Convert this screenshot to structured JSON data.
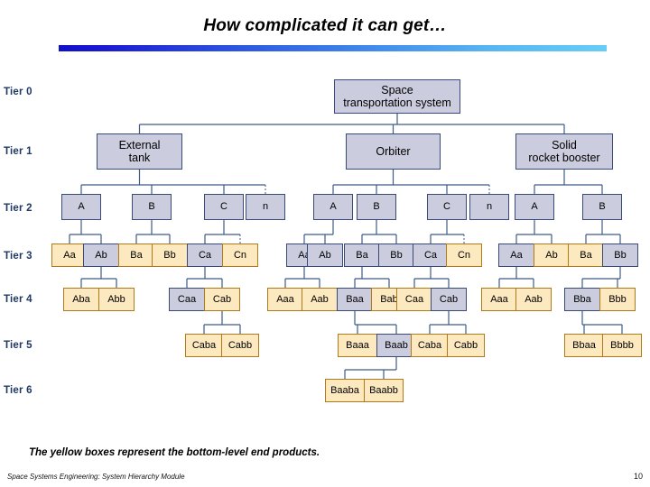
{
  "title": "How complicated it can get…",
  "accent_colors": {
    "start": "#1010c8",
    "end": "#66cdf7"
  },
  "legend": {
    "caption": "The yellow boxes represent the bottom-level end products."
  },
  "footer": {
    "source": "Space Systems Engineering: System Hierarchy Module",
    "page": "10"
  },
  "tiers": [
    {
      "label": "Tier 0"
    },
    {
      "label": "Tier 1"
    },
    {
      "label": "Tier 2"
    },
    {
      "label": "Tier 3"
    },
    {
      "label": "Tier 4"
    },
    {
      "label": "Tier 5"
    },
    {
      "label": "Tier 6"
    }
  ],
  "colors": {
    "blue_fill": "#ccccdf",
    "blue_border": "#3a4a78",
    "yellow_fill": "#fde9c0",
    "yellow_border": "#b07a1a",
    "tier_label": "#1f3864",
    "wire": "#3f5b87"
  },
  "nodes": {
    "tier0": [
      {
        "id": "sts",
        "label_line1": "Space",
        "label_line2": "transportation system",
        "color": "blue"
      }
    ],
    "tier1": [
      {
        "id": "et",
        "label_line1": "External",
        "label_line2": "tank",
        "color": "blue"
      },
      {
        "id": "orb",
        "label_line1": "Orbiter",
        "label_line2": "",
        "color": "blue"
      },
      {
        "id": "srb",
        "label_line1": "Solid",
        "label_line2": "rocket booster",
        "color": "blue"
      }
    ],
    "tier2": [
      {
        "id": "et-a",
        "label": "A",
        "color": "blue"
      },
      {
        "id": "et-b",
        "label": "B",
        "color": "blue"
      },
      {
        "id": "et-c",
        "label": "C",
        "color": "blue"
      },
      {
        "id": "et-n",
        "label": "n",
        "color": "blue"
      },
      {
        "id": "orb-a",
        "label": "A",
        "color": "blue"
      },
      {
        "id": "orb-b",
        "label": "B",
        "color": "blue"
      },
      {
        "id": "orb-c",
        "label": "C",
        "color": "blue"
      },
      {
        "id": "orb-n",
        "label": "n",
        "color": "blue"
      },
      {
        "id": "srb-a",
        "label": "A",
        "color": "blue"
      },
      {
        "id": "srb-b",
        "label": "B",
        "color": "blue"
      }
    ],
    "tier3": [
      {
        "id": "et-aa",
        "label": "Aa",
        "color": "yellow"
      },
      {
        "id": "et-ab",
        "label": "Ab",
        "color": "blue"
      },
      {
        "id": "et-ba",
        "label": "Ba",
        "color": "yellow"
      },
      {
        "id": "et-bb",
        "label": "Bb",
        "color": "yellow"
      },
      {
        "id": "et-ca",
        "label": "Ca",
        "color": "blue"
      },
      {
        "id": "et-cn",
        "label": "Cn",
        "color": "yellow"
      },
      {
        "id": "orb-aa",
        "label": "Aa",
        "color": "blue"
      },
      {
        "id": "orb-ab",
        "label": "Ab",
        "color": "blue"
      },
      {
        "id": "orb-ba",
        "label": "Ba",
        "color": "blue"
      },
      {
        "id": "orb-bb",
        "label": "Bb",
        "color": "blue"
      },
      {
        "id": "orb-ca",
        "label": "Ca",
        "color": "blue"
      },
      {
        "id": "orb-cn",
        "label": "Cn",
        "color": "yellow"
      },
      {
        "id": "srb-aa",
        "label": "Aa",
        "color": "blue"
      },
      {
        "id": "srb-ab",
        "label": "Ab",
        "color": "yellow"
      },
      {
        "id": "srb-ba",
        "label": "Ba",
        "color": "yellow"
      },
      {
        "id": "srb-bb",
        "label": "Bb",
        "color": "blue"
      }
    ],
    "tier4": [
      {
        "id": "et-aba",
        "label": "Aba",
        "color": "yellow"
      },
      {
        "id": "et-abb",
        "label": "Abb",
        "color": "yellow"
      },
      {
        "id": "et-caa",
        "label": "Caa",
        "color": "blue"
      },
      {
        "id": "et-cab",
        "label": "Cab",
        "color": "yellow"
      },
      {
        "id": "orb-aaa",
        "label": "Aaa",
        "color": "yellow"
      },
      {
        "id": "orb-aab",
        "label": "Aab",
        "color": "yellow"
      },
      {
        "id": "orb-baa",
        "label": "Baa",
        "color": "blue"
      },
      {
        "id": "orb-bab",
        "label": "Bab",
        "color": "yellow"
      },
      {
        "id": "orb-caa",
        "label": "Caa",
        "color": "yellow"
      },
      {
        "id": "orb-cab",
        "label": "Cab",
        "color": "blue"
      },
      {
        "id": "srb-aaa",
        "label": "Aaa",
        "color": "yellow"
      },
      {
        "id": "srb-aab",
        "label": "Aab",
        "color": "yellow"
      },
      {
        "id": "srb-bba",
        "label": "Bba",
        "color": "blue"
      },
      {
        "id": "srb-bbb",
        "label": "Bbb",
        "color": "yellow"
      }
    ],
    "tier5": [
      {
        "id": "et-caba",
        "label": "Caba",
        "color": "yellow"
      },
      {
        "id": "et-cabb",
        "label": "Cabb",
        "color": "yellow"
      },
      {
        "id": "orb-baaa",
        "label": "Baaa",
        "color": "yellow"
      },
      {
        "id": "orb-baab",
        "label": "Baab",
        "color": "blue"
      },
      {
        "id": "orb-caba",
        "label": "Caba",
        "color": "yellow"
      },
      {
        "id": "orb-cabb",
        "label": "Cabb",
        "color": "yellow"
      },
      {
        "id": "srb-bbaa",
        "label": "Bbaa",
        "color": "yellow"
      },
      {
        "id": "srb-bbbb",
        "label": "Bbbb",
        "color": "yellow"
      }
    ],
    "tier6": [
      {
        "id": "orb-baaba",
        "label": "Baaba",
        "color": "yellow"
      },
      {
        "id": "orb-baabb",
        "label": "Baabb",
        "color": "yellow"
      }
    ]
  }
}
